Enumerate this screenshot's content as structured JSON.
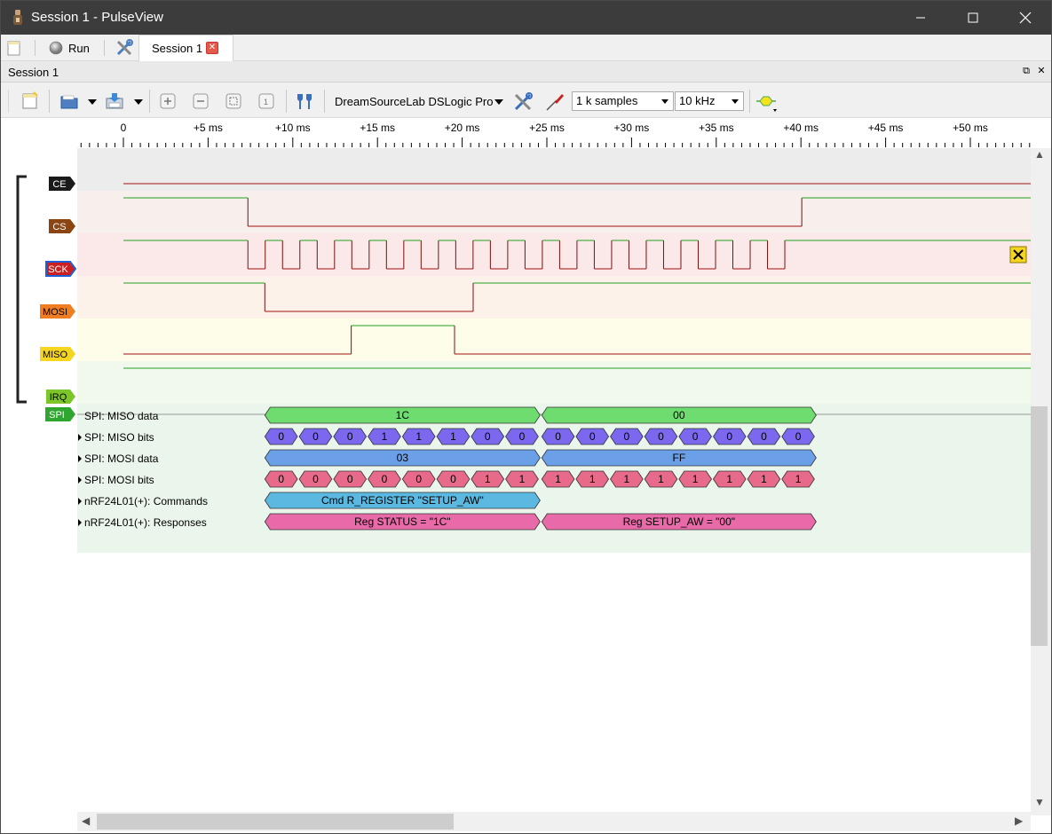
{
  "window": {
    "title": "Session 1 - PulseView",
    "controls": {
      "minimize": "—",
      "maximize": "☐",
      "close": "✕"
    }
  },
  "tabstrip": {
    "run_label": "Run",
    "session_tab_label": "Session 1",
    "session_tab_close": "✕"
  },
  "session_header": {
    "label": "Session 1",
    "float_button": "⧉",
    "close_button": "✕"
  },
  "toolbar": {
    "device": "DreamSourceLab DSLogic Pro",
    "samples": "1 k samples",
    "samplerate": "10 kHz"
  },
  "ruler": {
    "labels": [
      "0",
      "+5 ms",
      "+10 ms",
      "+15 ms",
      "+20 ms",
      "+25 ms",
      "+30 ms",
      "+35 ms",
      "+40 ms",
      "+45 ms",
      "+50 ms"
    ]
  },
  "signals": [
    {
      "name": "CE",
      "tag_color": "#1a1a1a",
      "text_color": "#ffffff",
      "band_color": "#ececec"
    },
    {
      "name": "CS",
      "tag_color": "#8b4513",
      "text_color": "#ffffff",
      "band_color": "#f6efeb"
    },
    {
      "name": "SCK",
      "tag_color": "#cc1f1f",
      "text_color": "#ffffff",
      "band_color": "#fbe8e8"
    },
    {
      "name": "MOSI",
      "tag_color": "#f07d1f",
      "text_color": "#000000",
      "band_color": "#fdf2ea"
    },
    {
      "name": "MISO",
      "tag_color": "#f5d51f",
      "text_color": "#000000",
      "band_color": "#fefdea"
    },
    {
      "name": "IRQ",
      "tag_color": "#7dc62a",
      "text_color": "#000000",
      "band_color": "#f1f8ec"
    }
  ],
  "decoder": {
    "tag": "SPI",
    "tag_color": "#2fa62f",
    "band_color": "#eaf5ec",
    "rows": [
      {
        "label": "SPI: MISO data",
        "annotations": [
          {
            "text": "1C"
          },
          {
            "text": "00"
          }
        ]
      },
      {
        "label": "SPI: MISO bits",
        "bits": [
          "0",
          "0",
          "0",
          "1",
          "1",
          "1",
          "0",
          "0",
          "0",
          "0",
          "0",
          "0",
          "0",
          "0",
          "0",
          "0"
        ]
      },
      {
        "label": "SPI: MOSI data",
        "annotations": [
          {
            "text": "03"
          },
          {
            "text": "FF"
          }
        ]
      },
      {
        "label": "SPI: MOSI bits",
        "bits": [
          "0",
          "0",
          "0",
          "0",
          "0",
          "0",
          "1",
          "1",
          "1",
          "1",
          "1",
          "1",
          "1",
          "1",
          "1",
          "1"
        ]
      },
      {
        "label": "nRF24L01(+): Commands",
        "annotations": [
          {
            "text": "Cmd R_REGISTER \"SETUP_AW\""
          }
        ]
      },
      {
        "label": "nRF24L01(+): Responses",
        "annotations": [
          {
            "text": "Reg STATUS = \"1C\""
          },
          {
            "text": "Reg SETUP_AW = \"00\""
          }
        ]
      }
    ],
    "colors": {
      "miso_data": "#6fdc6f",
      "miso_bits": "#7b68ee",
      "mosi_data": "#6b9fe8",
      "mosi_bits": "#e86a8a",
      "commands": "#5bb8e0",
      "responses": "#e86aa8"
    }
  }
}
